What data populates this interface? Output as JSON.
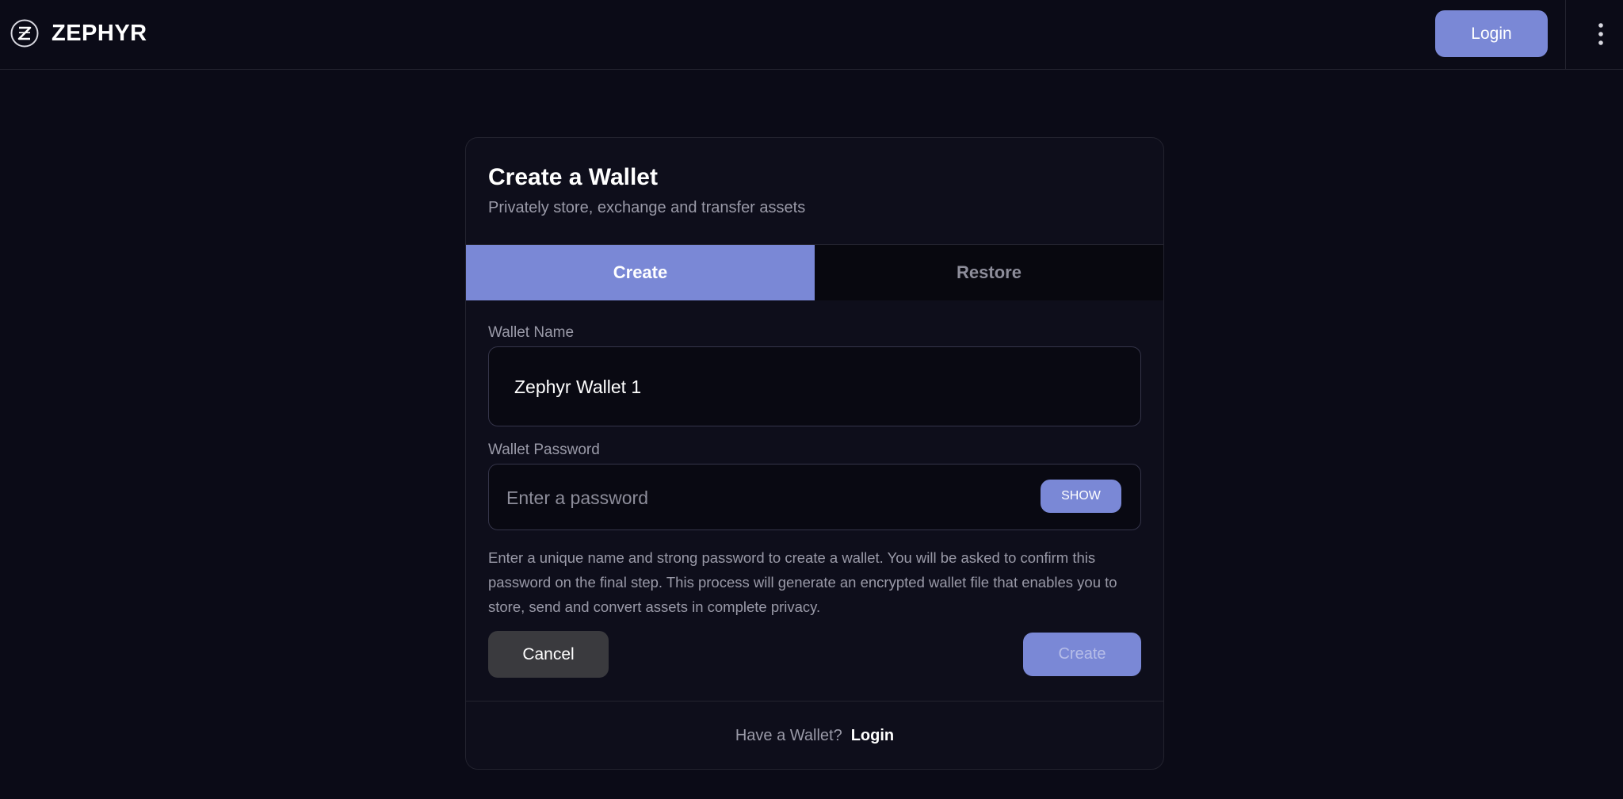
{
  "header": {
    "brand_name": "ZEPHYR",
    "login_label": "Login"
  },
  "card": {
    "title": "Create a Wallet",
    "subtitle": "Privately store, exchange and transfer assets",
    "tabs": [
      {
        "label": "Create",
        "active": true
      },
      {
        "label": "Restore",
        "active": false
      }
    ],
    "wallet_name": {
      "label": "Wallet Name",
      "value": "Zephyr Wallet 1"
    },
    "wallet_password": {
      "label": "Wallet Password",
      "placeholder": "Enter a password",
      "show_label": "SHOW"
    },
    "help_text": "Enter a unique name and strong password to create a wallet. You will be asked to confirm this password on the final step. This process will generate an encrypted wallet file that enables you to store, send and convert assets in complete privacy.",
    "cancel_label": "Cancel",
    "create_label": "Create",
    "footer": {
      "text": "Have a Wallet?",
      "link_label": "Login"
    }
  },
  "colors": {
    "background": "#0b0b17",
    "accent": "#7a88d6",
    "card": "#0e0e1b",
    "muted_text": "#9a9aa8"
  },
  "icons": {
    "brand_logo": "zephyr-logo-icon",
    "menu": "vertical-dots-menu-icon"
  }
}
